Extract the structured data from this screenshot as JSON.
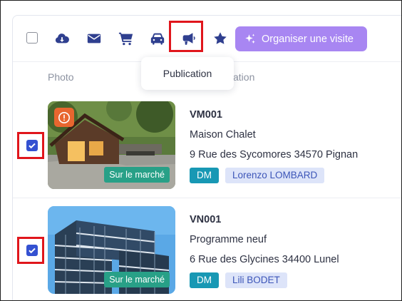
{
  "toolbar": {
    "icons": [
      "cloud-download-icon",
      "envelope-icon",
      "cart-icon",
      "car-icon",
      "megaphone-icon",
      "star-icon"
    ],
    "organize_visit_label": "Organiser une visite",
    "tooltip": "Publication",
    "icon_color": "#2f3f8f",
    "accent_color": "#a886f2"
  },
  "table": {
    "columns": [
      "Photo",
      "ation"
    ]
  },
  "listings": [
    {
      "ref": "VM001",
      "type": "Maison Chalet",
      "address": "9 Rue des Sycomores 34570 Pignan",
      "status": "Sur le marché",
      "mandate": "DM",
      "agent": "Lorenzo LOMBARD",
      "checked": true,
      "alert": true
    },
    {
      "ref": "VN001",
      "type": "Programme neuf",
      "address": "6 Rue des Glycines 34400 Lunel",
      "status": "Sur le marché",
      "mandate": "DM",
      "agent": "Lili BODET",
      "checked": true,
      "alert": false
    }
  ]
}
